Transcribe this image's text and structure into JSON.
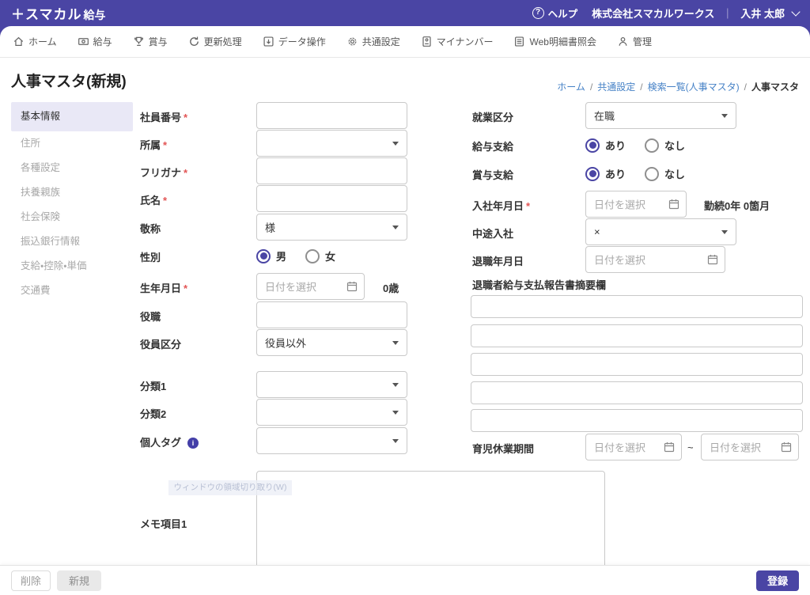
{
  "header": {
    "logo_main": "＋スマカル",
    "logo_sub": "給与",
    "help_label": "ヘルプ",
    "help_glyph": "?",
    "company": "株式会社スマカルワークス",
    "divider": "｜",
    "user": "入井 太郎"
  },
  "nav": {
    "items": [
      {
        "label": "ホーム",
        "icon": "home"
      },
      {
        "label": "給与",
        "icon": "banknote"
      },
      {
        "label": "賞与",
        "icon": "trophy"
      },
      {
        "label": "更新処理",
        "icon": "refresh"
      },
      {
        "label": "データ操作",
        "icon": "tray-download"
      },
      {
        "label": "共通設定",
        "icon": "gear"
      },
      {
        "label": "マイナンバー",
        "icon": "id-card"
      },
      {
        "label": "Web明細書照会",
        "icon": "document"
      },
      {
        "label": "管理",
        "icon": "person"
      }
    ]
  },
  "page": {
    "title": "人事マスタ(新規)"
  },
  "breadcrumb": {
    "separator": "/",
    "links": [
      "ホーム",
      "共通設定",
      "検索一覧(人事マスタ)"
    ],
    "current": "人事マスタ"
  },
  "sidebar": {
    "items": [
      "基本情報",
      "住所",
      "各種設定",
      "扶養親族",
      "社会保険",
      "振込銀行情報",
      "支給・控除・単価",
      "交通費"
    ]
  },
  "form": {
    "date_placeholder": "日付を選択",
    "employee_no": {
      "label": "社員番号",
      "required": "*",
      "value": ""
    },
    "department": {
      "label": "所属",
      "required": "*",
      "value": ""
    },
    "furigana": {
      "label": "フリガナ",
      "required": "*",
      "value": ""
    },
    "full_name": {
      "label": "氏名",
      "required": "*",
      "value": ""
    },
    "honorific": {
      "label": "敬称",
      "value": "様"
    },
    "gender": {
      "label": "性別",
      "options": [
        "男",
        "女"
      ],
      "selected": "男"
    },
    "birth_date": {
      "label": "生年月日",
      "required": "*",
      "age_text": "0歳"
    },
    "position": {
      "label": "役職",
      "value": ""
    },
    "officer_class": {
      "label": "役員区分",
      "value": "役員以外"
    },
    "category1": {
      "label": "分類1",
      "value": ""
    },
    "category2": {
      "label": "分類2",
      "value": ""
    },
    "personal_tag": {
      "label": "個人タグ",
      "info": "i",
      "value": ""
    },
    "memo1": {
      "label": "メモ項目1",
      "value": ""
    },
    "employment_status": {
      "label": "就業区分",
      "value": "在職"
    },
    "salary_payment": {
      "label": "給与支給",
      "options": [
        "あり",
        "なし"
      ],
      "selected": "あり"
    },
    "bonus_payment": {
      "label": "賞与支給",
      "options": [
        "あり",
        "なし"
      ],
      "selected": "あり"
    },
    "hire_date": {
      "label": "入社年月日",
      "required": "*",
      "tenure_text": "勤続0年 0箇月"
    },
    "mid_career": {
      "label": "中途入社",
      "value": "×"
    },
    "retire_date": {
      "label": "退職年月日"
    },
    "retire_report": {
      "label": "退職者給与支払報告書摘要欄",
      "values": [
        "",
        "",
        "",
        "",
        ""
      ]
    },
    "childcare_leave": {
      "label": "育児休業期間",
      "tilde": "~"
    }
  },
  "footer": {
    "delete_label": "削除",
    "new_label": "新規",
    "submit_label": "登録"
  },
  "artifact": {
    "ghost_tooltip": "ウィンドウの領域切り取り(W)"
  }
}
